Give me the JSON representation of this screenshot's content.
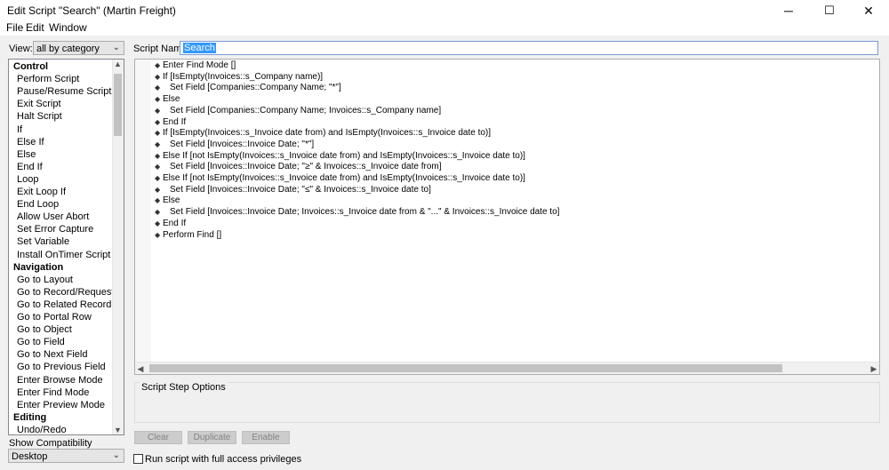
{
  "window": {
    "title": "Edit Script \"Search\" (Martin Freight)",
    "minimize_label": "─",
    "maximize_label": "☐",
    "close_label": "✕"
  },
  "menu": [
    "File",
    "Edit",
    "Window"
  ],
  "left": {
    "view_label": "View:",
    "view_value": "all by category",
    "show_compat_label": "Show Compatibility",
    "compat_value": "Desktop",
    "steps": [
      {
        "type": "cat",
        "label": "Control"
      },
      {
        "type": "item",
        "label": "Perform Script"
      },
      {
        "type": "item",
        "label": "Pause/Resume Script"
      },
      {
        "type": "item",
        "label": "Exit Script"
      },
      {
        "type": "item",
        "label": "Halt Script"
      },
      {
        "type": "item",
        "label": "If"
      },
      {
        "type": "item",
        "label": "Else If"
      },
      {
        "type": "item",
        "label": "Else"
      },
      {
        "type": "item",
        "label": "End If"
      },
      {
        "type": "item",
        "label": "Loop"
      },
      {
        "type": "item",
        "label": "Exit Loop If"
      },
      {
        "type": "item",
        "label": "End Loop"
      },
      {
        "type": "item",
        "label": "Allow User Abort"
      },
      {
        "type": "item",
        "label": "Set Error Capture"
      },
      {
        "type": "item",
        "label": "Set Variable"
      },
      {
        "type": "item",
        "label": "Install OnTimer Script"
      },
      {
        "type": "cat",
        "label": "Navigation"
      },
      {
        "type": "item",
        "label": "Go to Layout"
      },
      {
        "type": "item",
        "label": "Go to Record/Request/Page"
      },
      {
        "type": "item",
        "label": "Go to Related Record"
      },
      {
        "type": "item",
        "label": "Go to Portal Row"
      },
      {
        "type": "item",
        "label": "Go to Object"
      },
      {
        "type": "item",
        "label": "Go to Field"
      },
      {
        "type": "item",
        "label": "Go to Next Field"
      },
      {
        "type": "item",
        "label": "Go to Previous Field"
      },
      {
        "type": "item",
        "label": "Enter Browse Mode"
      },
      {
        "type": "item",
        "label": "Enter Find Mode"
      },
      {
        "type": "item",
        "label": "Enter Preview Mode"
      },
      {
        "type": "cat",
        "label": "Editing"
      },
      {
        "type": "item",
        "label": "Undo/Redo"
      }
    ]
  },
  "script": {
    "name_label": "Script Name:",
    "name_value": "Search",
    "lines": [
      {
        "indent": 0,
        "text": "Enter Find Mode []"
      },
      {
        "indent": 0,
        "text": "If [IsEmpty(Invoices::s_Company name)]"
      },
      {
        "indent": 1,
        "text": "Set Field [Companies::Company Name; \"*\"]"
      },
      {
        "indent": 0,
        "text": "Else"
      },
      {
        "indent": 1,
        "text": "Set Field [Companies::Company Name; Invoices::s_Company name]"
      },
      {
        "indent": 0,
        "text": "End If"
      },
      {
        "indent": 0,
        "text": "If [IsEmpty(Invoices::s_Invoice date from) and IsEmpty(Invoices::s_Invoice date to)]"
      },
      {
        "indent": 1,
        "text": "Set Field [Invoices::Invoice Date; \"*\"]"
      },
      {
        "indent": 0,
        "text": "Else If [not IsEmpty(Invoices::s_Invoice date from) and IsEmpty(Invoices::s_Invoice date to)]"
      },
      {
        "indent": 1,
        "text": "Set Field [Invoices::Invoice Date; \"≥\" & Invoices::s_Invoice date from]"
      },
      {
        "indent": 0,
        "text": "Else If [not IsEmpty(Invoices::s_Invoice date from) and IsEmpty(Invoices::s_Invoice date to)]"
      },
      {
        "indent": 1,
        "text": "Set Field [Invoices::Invoice Date; \"≤\" & Invoices::s_Invoice date to]"
      },
      {
        "indent": 0,
        "text": "Else"
      },
      {
        "indent": 1,
        "text": "Set Field [Invoices::Invoice Date; Invoices::s_Invoice date from & \"...\" & Invoices::s_Invoice date to]"
      },
      {
        "indent": 0,
        "text": "End If"
      },
      {
        "indent": 0,
        "text": "Perform Find []"
      }
    ],
    "step_options_label": "Script Step Options",
    "buttons": {
      "clear": "Clear",
      "duplicate": "Duplicate",
      "enable": "Enable"
    },
    "full_access_label": "Run script with full access privileges"
  },
  "icons": {
    "step_marker": "diamond-icon",
    "scroll_up": "chevron-up-icon",
    "scroll_down": "chevron-down-icon",
    "scroll_left": "chevron-left-icon",
    "scroll_right": "chevron-right-icon"
  },
  "colors": {
    "selection": "#3399ff",
    "panel": "#f0f0f0"
  }
}
